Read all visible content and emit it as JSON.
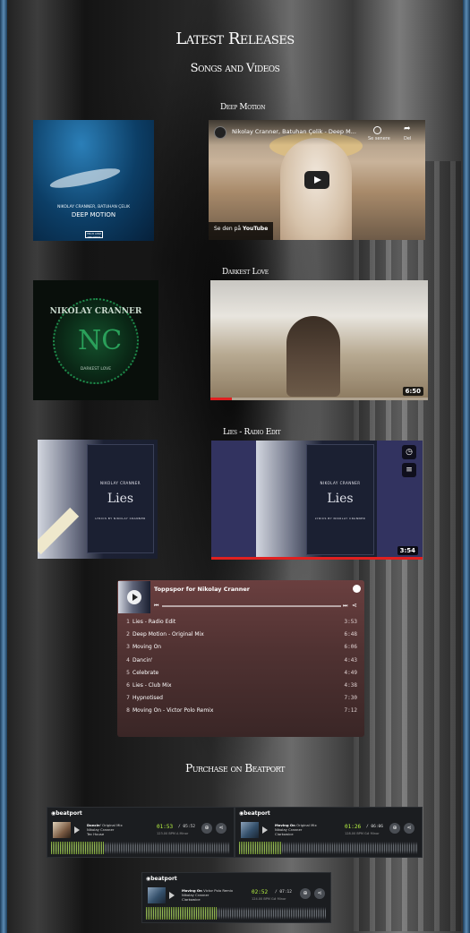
{
  "header": {
    "title": "Latest Releases",
    "subtitle": "Songs and Videos"
  },
  "releases": [
    {
      "title": "Deep Motion",
      "cover": {
        "artist_line": "NIKOLAY CRANNER, BATUHAN ÇELIK",
        "title": "DEEP MOTION",
        "label": "TECH CHIP RECORDS"
      },
      "video": {
        "title": "Nikolay Cranner, Batuhan Çelik - Deep M...",
        "watch_later": "Se senere",
        "share": "Del",
        "watch_on": "Se den på",
        "platform": "YouTube"
      }
    },
    {
      "title": "Darkest Love",
      "cover": {
        "artist_line": "NIKOLAY CRANNER",
        "monogram": "NC",
        "title": "DARKEST LOVE"
      },
      "video": {
        "duration": "6:50",
        "progress": 0.1
      }
    },
    {
      "title": "Lies - Radio Edit",
      "cover": {
        "artist_line": "NIKOLAY CRANNER",
        "title": "Lies",
        "tagline": "LYRICS BY NIKOLAY CRANNER"
      },
      "video": {
        "duration": "3:54",
        "progress": 1.0
      }
    }
  ],
  "spotify": {
    "title": "Toppspor for Nikolay Cranner",
    "tracks": [
      {
        "num": "1",
        "name": "Lies - Radio Edit",
        "duration": "3:53"
      },
      {
        "num": "2",
        "name": "Deep Motion - Original Mix",
        "duration": "6:48"
      },
      {
        "num": "3",
        "name": "Moving On",
        "duration": "6:06"
      },
      {
        "num": "4",
        "name": "Dancin'",
        "duration": "4:43"
      },
      {
        "num": "5",
        "name": "Celebrate",
        "duration": "4:49"
      },
      {
        "num": "6",
        "name": "Lies - Club Mix",
        "duration": "4:38"
      },
      {
        "num": "7",
        "name": "Hypnotised",
        "duration": "7:30"
      },
      {
        "num": "8",
        "name": "Moving On - Victor Polo Remix",
        "duration": "7:12"
      }
    ]
  },
  "purchase": {
    "title": "Purchase on Beatport",
    "logo": "beatport",
    "players": [
      {
        "track": "Dancin'",
        "mix": "Original Mix",
        "artist": "Nikolay Cranner",
        "label": "Tec House",
        "time": "01:53",
        "total": "/ 05:52",
        "meta": "123.00 BPM   A Minor"
      },
      {
        "track": "Moving On",
        "mix": "Original Mix",
        "artist": "Nikolay Cranner",
        "label": "Clarkowice",
        "time": "01:26",
        "total": "/ 06:06",
        "meta": "128.00 BPM   G# Minor"
      },
      {
        "track": "Moving On",
        "mix": "Victor Polo Remix",
        "artist": "Nikolay Cranner",
        "label": "Clarkowice",
        "time": "02:52",
        "total": "/ 07:12",
        "meta": "124.00 BPM   G# Minor"
      }
    ]
  }
}
